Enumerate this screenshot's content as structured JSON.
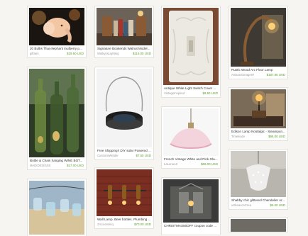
{
  "items": [
    {
      "title": "20 Bulbs Thai elephant mulberry pa...",
      "shop": "giftrain",
      "price": "$19.50 USD"
    },
    {
      "title": "Signature Bookends Walnut Model...",
      "shop": "WatkynsLighting",
      "price": "$115.00 USD"
    },
    {
      "title": "Antique White Light Switch Cover ...",
      "shop": "VintageInspired",
      "price": "$9.50 USD"
    },
    {
      "title": "Rustic Wood Arc Floor Lamp",
      "shop": "ArtisanStorage07",
      "price": "$187.95 USD"
    },
    {
      "title": "Bottle & Chain hanging WINE BOT...",
      "shop": "MADIDESIGNS",
      "price": "$17.00 USD"
    },
    {
      "title": "Free Shipping!! DIY solar Powered ...",
      "shop": "CustomsWelder",
      "price": "$7.50 USD"
    },
    {
      "title": "French Vintage White and Pink Gla...",
      "shop": "LaLunaArt",
      "price": "$69.00 USD"
    },
    {
      "title": "Edison Lamp Nostalgic - Steampun...",
      "shop": "Timeleaze",
      "price": "$95.00 USD"
    },
    {
      "title": "Wall Lamp. Beer bottles. Plumbing ...",
      "shop": "2ALicensinq",
      "price": "$70.00 USD"
    },
    {
      "title": "CHRISTMAS50OFF coupon code ...",
      "shop": "",
      "price": ""
    },
    {
      "title": "Shabby chic glittered Chandelier or...",
      "shop": "uSbeaconCrea",
      "price": "$6.00 USD"
    }
  ]
}
